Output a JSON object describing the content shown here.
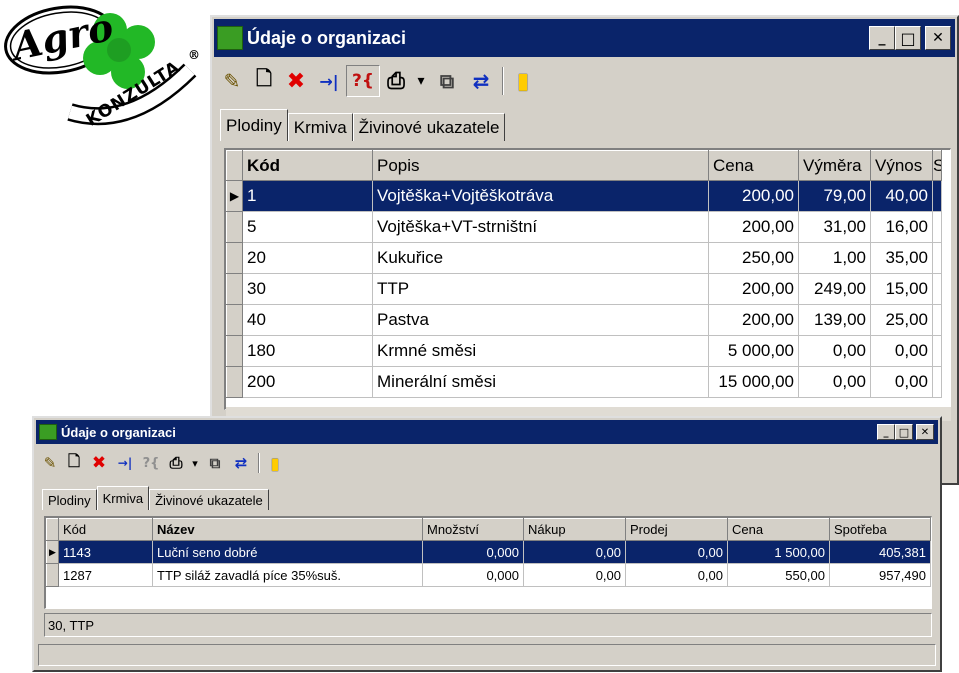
{
  "logo": {
    "script_text": "Agro",
    "brand_text": "KONZULTA",
    "reg_mark": "®",
    "clover_color": "#22b826"
  },
  "colors": {
    "titlebar": "#0a246a",
    "selection": "#0a246a",
    "face": "#d4d0c8"
  },
  "window1": {
    "title": "Údaje o organizaci",
    "window_buttons": {
      "minimize": "_",
      "maximize": "□",
      "close": "✕"
    },
    "toolbar": [
      {
        "name": "edit-record-icon",
        "glyph": "✎",
        "color": "#6b5200"
      },
      {
        "name": "new-record-icon",
        "glyph": "🗋",
        "color": "#000000"
      },
      {
        "name": "delete-icon",
        "glyph": "✖",
        "color": "#e00000"
      },
      {
        "name": "goto-icon",
        "glyph": "→|",
        "color": "#1030c0"
      },
      {
        "name": "query-icon",
        "glyph": "?{",
        "color": "#c01010"
      },
      {
        "name": "print-icon",
        "glyph": "⎙",
        "color": "#000000"
      },
      {
        "name": "dropdown-arrow-icon",
        "glyph": "▾",
        "color": "#000000"
      },
      {
        "name": "copy-icon",
        "glyph": "⧉",
        "color": "#404040"
      },
      {
        "name": "refresh-icon",
        "glyph": "⇄",
        "color": "#1030c0"
      },
      {
        "name": "exit-door-icon",
        "glyph": "▮",
        "color": "#ffcc00"
      }
    ],
    "tabs": [
      "Plodiny",
      "Krmiva",
      "Živinové ukazatele"
    ],
    "active_tab": 0,
    "columns": [
      "Kód",
      "Popis",
      "Cena",
      "Výměra",
      "Výnos",
      "S"
    ],
    "rows": [
      [
        "1",
        "Vojtěška+Vojtěškotráva",
        "200,00",
        "79,00",
        "40,00"
      ],
      [
        "5",
        "Vojtěška+VT-strništní",
        "200,00",
        "31,00",
        "16,00"
      ],
      [
        "20",
        "Kukuřice",
        "250,00",
        "1,00",
        "35,00"
      ],
      [
        "30",
        "TTP",
        "200,00",
        "249,00",
        "15,00"
      ],
      [
        "40",
        "Pastva",
        "200,00",
        "139,00",
        "25,00"
      ],
      [
        "180",
        "Krmné směsi",
        "5 000,00",
        "0,00",
        "0,00"
      ],
      [
        "200",
        "Minerální směsi",
        "15 000,00",
        "0,00",
        "0,00"
      ]
    ],
    "selected_row": 0
  },
  "window2": {
    "title": "Údaje o organizaci",
    "window_buttons": {
      "minimize": "_",
      "maximize": "□",
      "close": "✕"
    },
    "tabs": [
      "Plodiny",
      "Krmiva",
      "Živinové ukazatele"
    ],
    "active_tab": 1,
    "columns": [
      "Kód",
      "Název",
      "Množství",
      "Nákup",
      "Prodej",
      "Cena",
      "Spotřeba"
    ],
    "rows": [
      [
        "1143",
        "Luční seno dobré",
        "0,000",
        "0,00",
        "0,00",
        "1 500,00",
        "405,381"
      ],
      [
        "1287",
        "TTP siláž zavadlá píce 35%suš.",
        "0,000",
        "0,00",
        "0,00",
        "550,00",
        "957,490"
      ]
    ],
    "selected_row": 0,
    "status_text": "30, TTP"
  }
}
